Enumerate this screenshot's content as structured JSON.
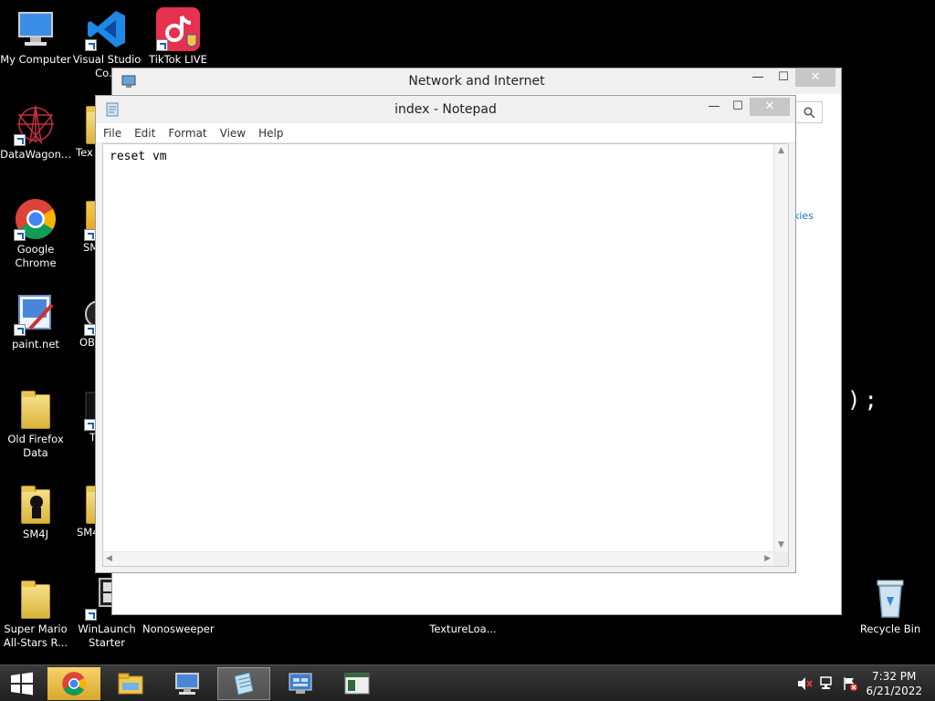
{
  "desktop_icons": [
    {
      "label": "My Computer"
    },
    {
      "label": "Visual Studio Co..."
    },
    {
      "label": "TikTok LIVE"
    },
    {
      "label": "DataWagon..."
    },
    {
      "label": "Tex"
    },
    {
      "label": "Google Chrome"
    },
    {
      "label": "SM"
    },
    {
      "label": "paint.net"
    },
    {
      "label": "OB"
    },
    {
      "label": "Old Firefox Data"
    },
    {
      "label": "T"
    },
    {
      "label": "SM4J"
    },
    {
      "label": "SM4"
    },
    {
      "label": "Super Mario All-Stars R..."
    },
    {
      "label": "WinLaunch Starter"
    },
    {
      "label": "Nonosweeper"
    },
    {
      "label": "TextureLoa..."
    },
    {
      "label": "Recycle Bin"
    }
  ],
  "background_window": {
    "title": "Network and Internet",
    "partial_link": "kies",
    "minimize": "—",
    "maximize": "☐",
    "close": "✕"
  },
  "notepad": {
    "title": "index - Notepad",
    "menu": [
      "File",
      "Edit",
      "Format",
      "View",
      "Help"
    ],
    "content": "reset vm",
    "minimize": "—",
    "maximize": "☐",
    "close": "✕"
  },
  "desktop_fragment": ");",
  "taskbar": {
    "time": "7:32 PM",
    "date": "6/21/2022"
  },
  "colors": {
    "desktop_bg": "#000000",
    "taskbar_bg": "#2b2b2b",
    "link_color": "#1a6fc9"
  }
}
